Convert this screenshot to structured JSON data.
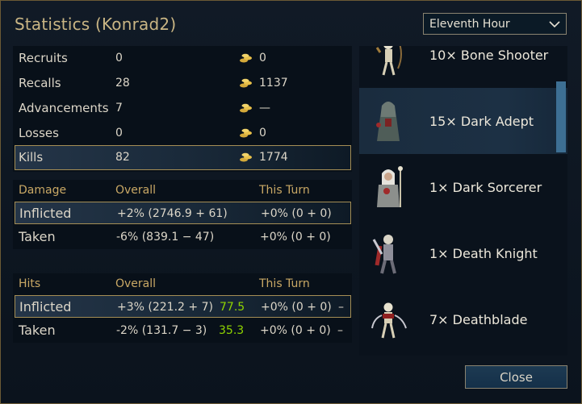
{
  "dialog": {
    "title": "Statistics (Konrad2)"
  },
  "dropdown": {
    "selected": "Eleventh Hour"
  },
  "summary": [
    {
      "label": "Recruits",
      "count": "0",
      "gold": "0"
    },
    {
      "label": "Recalls",
      "count": "28",
      "gold": "1137"
    },
    {
      "label": "Advancements",
      "count": "7",
      "gold": "—"
    },
    {
      "label": "Losses",
      "count": "0",
      "gold": "0"
    },
    {
      "label": "Kills",
      "count": "82",
      "gold": "1774"
    }
  ],
  "damage": {
    "header": {
      "label": "Damage",
      "overall": "Overall",
      "this_turn": "This Turn"
    },
    "rows": [
      {
        "label": "Inflicted",
        "overall": "+2% (2746.9 + 61)",
        "this_turn": "+0% (0 + 0)"
      },
      {
        "label": "Taken",
        "overall": "-6% (839.1 − 47)",
        "this_turn": "+0% (0 + 0)"
      }
    ]
  },
  "hits": {
    "header": {
      "label": "Hits",
      "overall": "Overall",
      "this_turn": "This Turn"
    },
    "rows": [
      {
        "label": "Inflicted",
        "overall": "+3% (221.2 + 7)",
        "percent": "77.5",
        "this_turn": "+0% (0 + 0)",
        "extra": "–"
      },
      {
        "label": "Taken",
        "overall": "-2% (131.7 − 3)",
        "percent": "35.3",
        "this_turn": "+0% (0 + 0)",
        "extra": "–"
      }
    ]
  },
  "units": [
    {
      "label": "10× Bone Shooter",
      "icon": "bone-shooter-sprite"
    },
    {
      "label": "15× Dark Adept",
      "icon": "dark-adept-sprite"
    },
    {
      "label": "1× Dark Sorcerer",
      "icon": "dark-sorcerer-sprite"
    },
    {
      "label": "1× Death Knight",
      "icon": "death-knight-sprite"
    },
    {
      "label": "7× Deathblade",
      "icon": "deathblade-sprite"
    }
  ],
  "buttons": {
    "close": "Close"
  },
  "colors": {
    "gold_title": "#c9b584",
    "header_gold": "#c9a865",
    "percent_green": "#8fd400",
    "highlight_border": "#a58e55"
  }
}
